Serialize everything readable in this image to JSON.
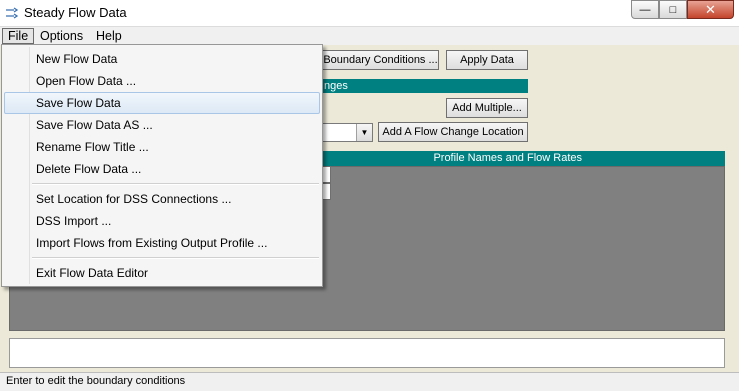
{
  "window": {
    "title": "Steady Flow Data",
    "minimize_label": "—",
    "maximize_label": "□",
    "close_label": "✕"
  },
  "menubar": {
    "file": "File",
    "options": "Options",
    "help": "Help"
  },
  "toolbar": {
    "boundary_conditions": "Boundary Conditions ...",
    "apply_data": "Apply Data",
    "add_multiple": "Add Multiple...",
    "add_flow_change_location": "Add A Flow Change Location"
  },
  "teal_bar_text": "nges",
  "grid": {
    "header": "Profile Names and Flow Rates"
  },
  "file_menu": {
    "items": [
      "New Flow Data",
      "Open Flow Data ...",
      "Save Flow Data",
      "Save Flow Data AS ...",
      "Rename Flow Title ...",
      "Delete Flow Data ...",
      "Set Location for DSS Connections ...",
      "DSS Import ...",
      "Import Flows from Existing Output Profile ...",
      "Exit Flow Data Editor"
    ],
    "highlighted": "Save Flow Data"
  },
  "status_bar": {
    "text": "Enter to edit the boundary conditions"
  },
  "colors": {
    "teal": "#008080",
    "grid_background": "#808080",
    "menu_highlight": "#dde9f6"
  }
}
